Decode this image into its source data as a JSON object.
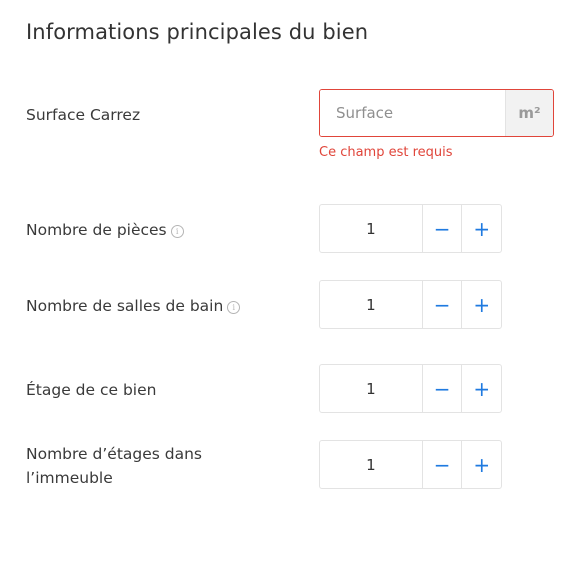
{
  "title": "Informations principales du bien",
  "surface": {
    "label": "Surface Carrez",
    "placeholder": "Surface",
    "value": "",
    "unit": "m²",
    "error": "Ce champ est requis",
    "error_color": "#e0453a"
  },
  "fields": [
    {
      "label": "Nombre de pièces",
      "value": "1",
      "has_info": true,
      "info_icon": "info-icon"
    },
    {
      "label": "Nombre de salles de bain",
      "value": "1",
      "has_info": true,
      "info_icon": "info-icon"
    },
    {
      "label": "Étage de ce bien",
      "value": "1",
      "has_info": false
    },
    {
      "label_line1": "Nombre d’étages dans",
      "label_line2": "l’immeuble",
      "value": "1",
      "has_info": false
    }
  ],
  "stepper": {
    "decrement": "−",
    "increment": "+",
    "accent_color": "#1f7ae0"
  },
  "info_glyph": "i"
}
